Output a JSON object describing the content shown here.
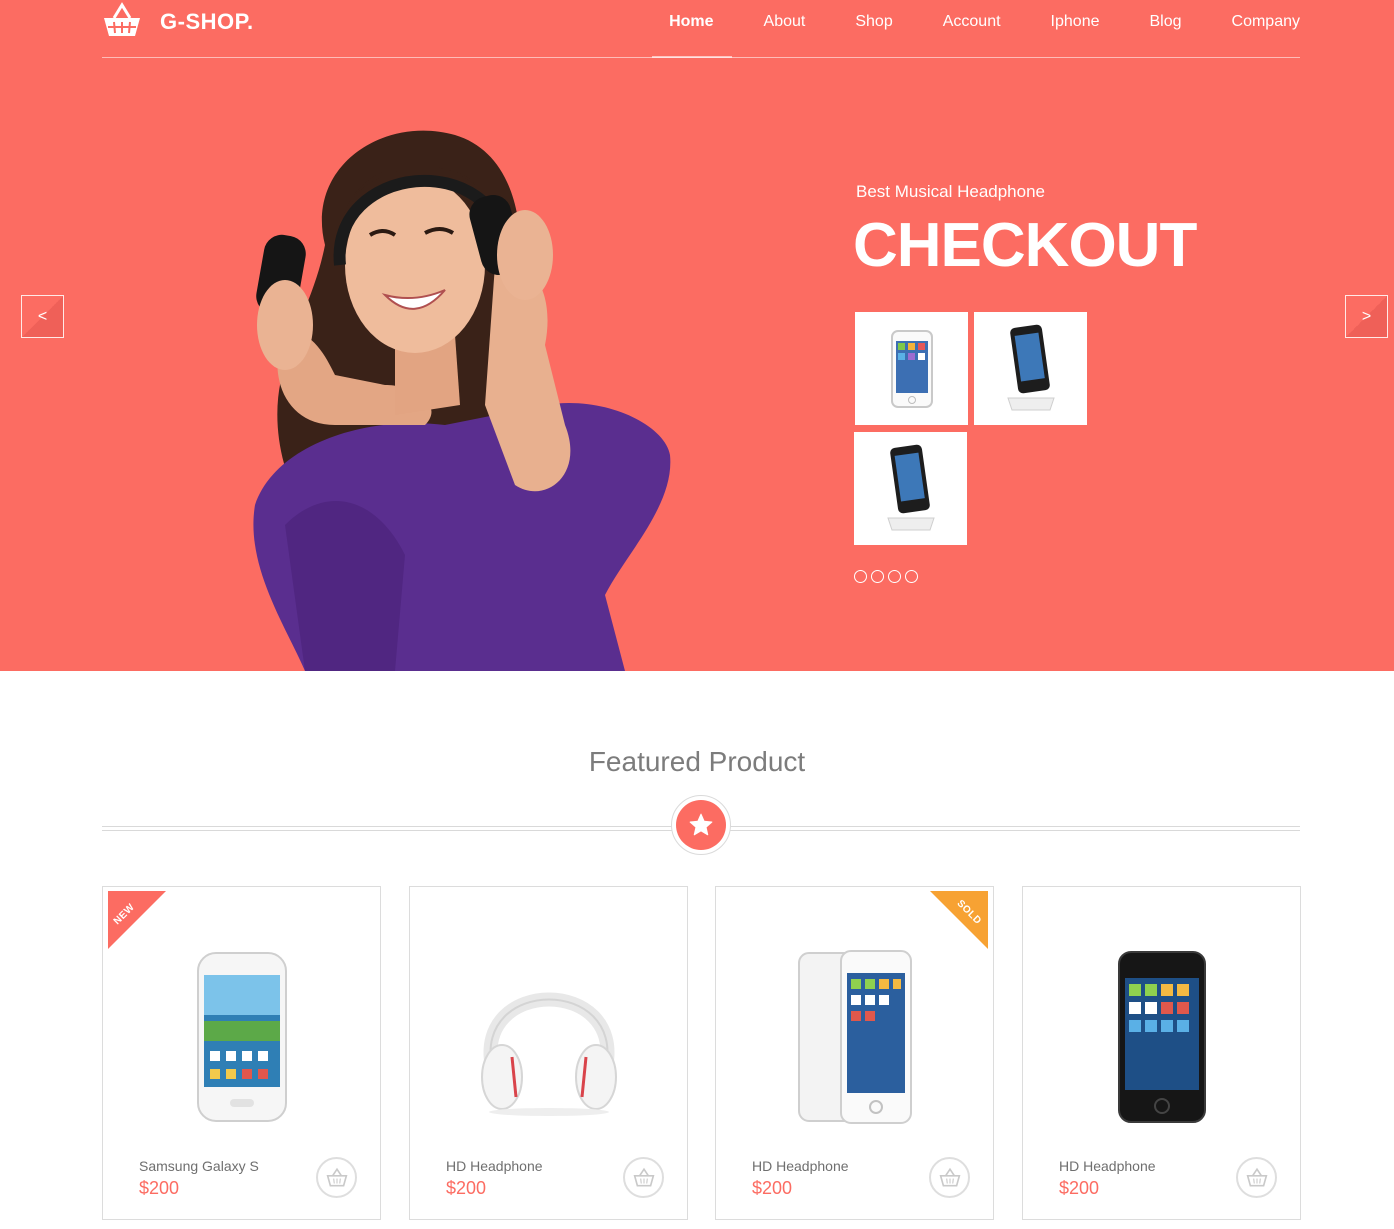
{
  "brand": {
    "name": "G-SHOP."
  },
  "nav": {
    "items": [
      {
        "label": "Home",
        "active": true
      },
      {
        "label": "About"
      },
      {
        "label": "Shop"
      },
      {
        "label": "Account"
      },
      {
        "label": "Iphone"
      },
      {
        "label": "Blog"
      },
      {
        "label": "Company"
      }
    ]
  },
  "hero": {
    "subtitle": "Best Musical Headphone",
    "title": "CHECKOUT",
    "prev_label": "<",
    "next_label": ">",
    "background_color": "#fc6c62",
    "dots_count": 4
  },
  "featured": {
    "title": "Featured Product",
    "products": [
      {
        "name": "Samsung Galaxy S",
        "price": "$200",
        "ribbon": "NEW",
        "image": "white-smartphone"
      },
      {
        "name": "HD Headphone",
        "price": "$200",
        "ribbon": "",
        "image": "white-headphones"
      },
      {
        "name": "HD Headphone",
        "price": "$200",
        "ribbon": "SOLD",
        "image": "white-iphone"
      },
      {
        "name": "HD Headphone",
        "price": "$200",
        "ribbon": "",
        "image": "black-iphone"
      }
    ]
  },
  "colors": {
    "accent": "#fc6c62",
    "sold": "#f7a233"
  }
}
